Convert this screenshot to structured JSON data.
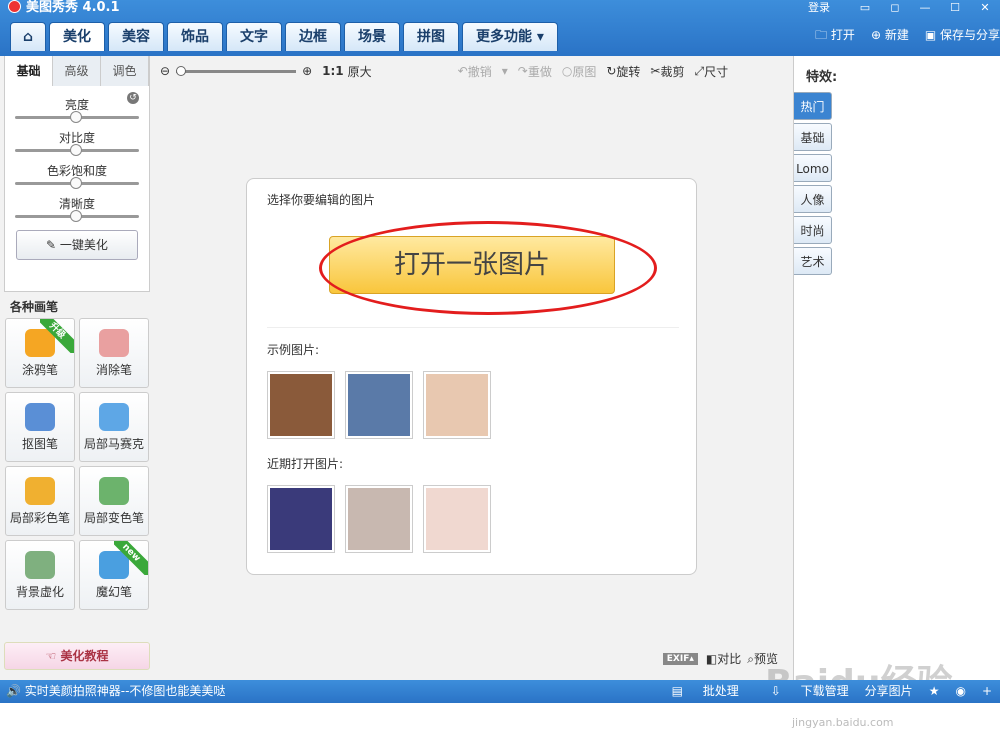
{
  "app": {
    "title": "美图秀秀 4.0.1",
    "login": "登录"
  },
  "tabs": [
    {
      "label": "⌂",
      "name": "home"
    },
    {
      "label": "美化"
    },
    {
      "label": "美容"
    },
    {
      "label": "饰品"
    },
    {
      "label": "文字"
    },
    {
      "label": "边框"
    },
    {
      "label": "场景"
    },
    {
      "label": "拼图"
    },
    {
      "label": "更多功能 ▾"
    }
  ],
  "top_actions": {
    "open": "打开",
    "new": "新建",
    "save": "保存与分享"
  },
  "left": {
    "subtabs": [
      "基础",
      "高级",
      "调色"
    ],
    "sliders": [
      {
        "label": "亮度",
        "value": 0.5
      },
      {
        "label": "对比度",
        "value": 0.5
      },
      {
        "label": "色彩饱和度",
        "value": 0.5
      },
      {
        "label": "清晰度",
        "value": 0.5
      }
    ],
    "onekey": "一键美化",
    "brush_title": "各种画笔",
    "brushes": [
      {
        "label": "涂鸦笔",
        "icon": "brush-icon",
        "badge": "升级",
        "color": "#f5a623"
      },
      {
        "label": "消除笔",
        "icon": "eraser-icon",
        "badge": "",
        "color": "#e9a0a0"
      },
      {
        "label": "抠图笔",
        "icon": "pen-icon",
        "badge": "",
        "color": "#5a8fd6"
      },
      {
        "label": "局部马赛克",
        "icon": "mosaic-icon",
        "badge": "",
        "color": "#5ea7e6"
      },
      {
        "label": "局部彩色笔",
        "icon": "color-brush-icon",
        "badge": "",
        "color": "#f0b030"
      },
      {
        "label": "局部变色笔",
        "icon": "paint-bucket-icon",
        "badge": "",
        "color": "#6cb36c"
      },
      {
        "label": "背景虚化",
        "icon": "blur-icon",
        "badge": "",
        "color": "#7fb07f"
      },
      {
        "label": "魔幻笔",
        "icon": "magic-pen-icon",
        "badge": "new",
        "color": "#4a9fe0"
      }
    ],
    "tutorial": "美化教程"
  },
  "toolbar": {
    "ratio": "1:1",
    "original_size": "原大",
    "undo": "撤销",
    "redo": "重做",
    "original": "原图",
    "rotate": "旋转",
    "crop": "裁剪",
    "size": "尺寸"
  },
  "panel": {
    "select_label": "选择你要编辑的图片",
    "open_button": "打开一张图片",
    "examples_label": "示例图片:",
    "recent_label": "近期打开图片:",
    "example_colors": [
      "#8a5a3a",
      "#5a7aa8",
      "#e8c8b0"
    ],
    "recent_colors": [
      "#3a3a7a",
      "#c8b8b0",
      "#f0d8d0"
    ]
  },
  "right": {
    "title": "特效:",
    "tabs": [
      "热门",
      "基础",
      "Lomo",
      "人像",
      "时尚",
      "艺术"
    ]
  },
  "bottom": {
    "exif": "EXIF▴",
    "compare": "对比",
    "preview": "预览"
  },
  "status": {
    "left": "实时美颜拍照神器--不修图也能美美哒",
    "batch": "批处理",
    "download": "下载管理",
    "share": "分享图片"
  },
  "watermark": {
    "main": "Baidu经验",
    "sub": "jingyan.baidu.com"
  }
}
